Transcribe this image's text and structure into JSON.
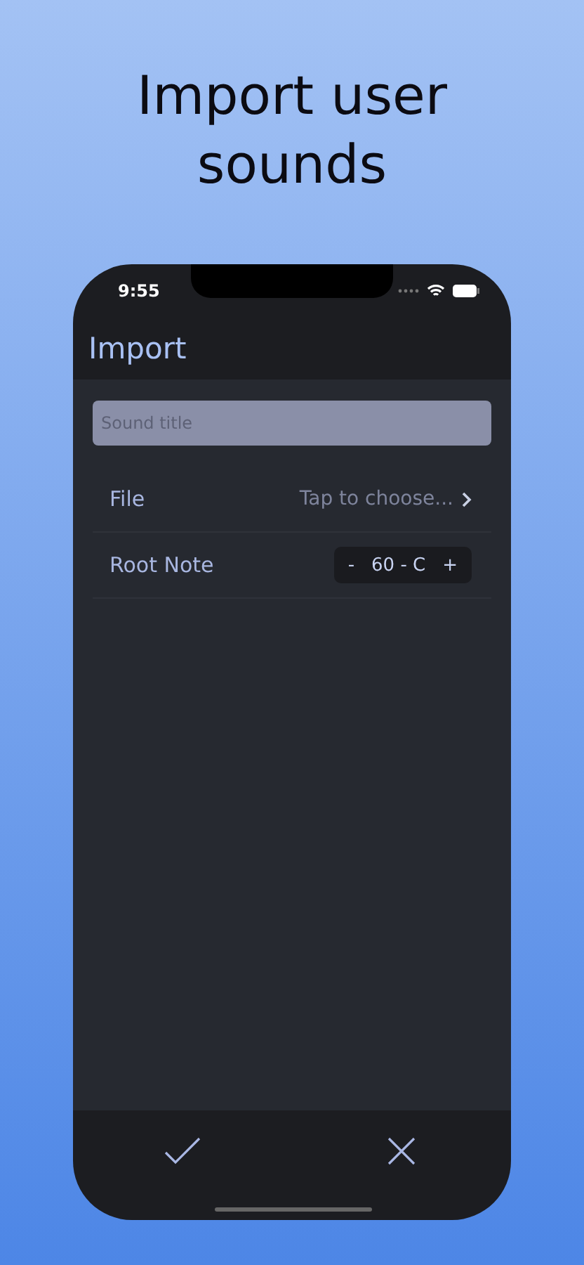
{
  "headline": "Import user sounds",
  "status_bar": {
    "time": "9:55"
  },
  "nav": {
    "title": "Import"
  },
  "title_field": {
    "placeholder": "Sound title"
  },
  "file_row": {
    "label": "File",
    "value": "Tap to choose..."
  },
  "root_note_row": {
    "label": "Root Note",
    "decrement": "-",
    "value": "60 - C",
    "increment": "+"
  }
}
